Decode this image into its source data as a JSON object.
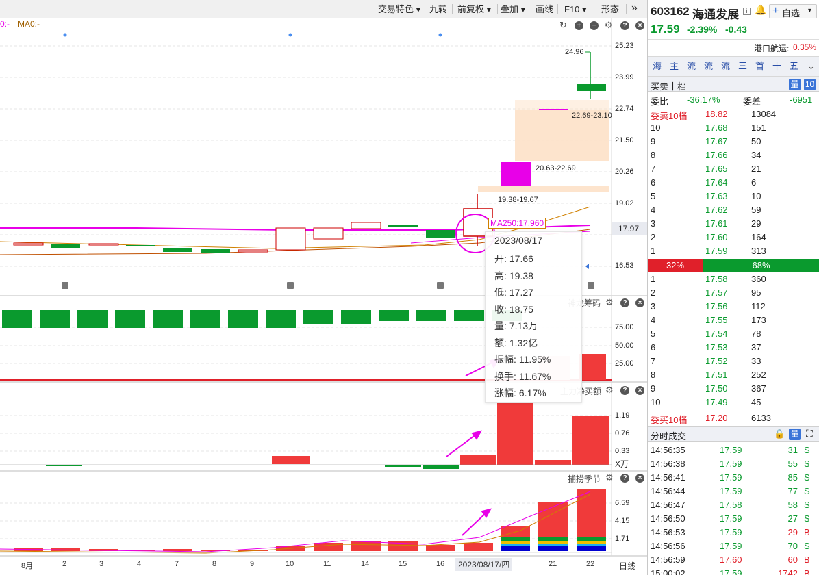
{
  "toolbar": {
    "items": [
      "交易特色",
      "九转",
      "前复权",
      "叠加",
      "画线",
      "F10",
      "形态"
    ],
    "expand": "»"
  },
  "ma_legend": {
    "ma_a": "0:-",
    "ma_b": "MA0:-"
  },
  "price_axis": [
    "25.23",
    "23.99",
    "22.74",
    "21.50",
    "20.26",
    "19.02",
    "17.97",
    "16.53"
  ],
  "annotations": {
    "high_label": "24.96",
    "zone1": "22.69-23.10",
    "zone2": "20.63-22.69",
    "zone3": "19.38-19.67",
    "ma250": "MA250:17.960",
    "current_price_tag": "17.97"
  },
  "panels": {
    "chip": {
      "title": "神龙筹码",
      "axis": [
        "75.00",
        "50.00",
        "25.00"
      ]
    },
    "main_buy": {
      "title": "主力净买额",
      "axis": [
        "1.19",
        "0.76",
        "0.33"
      ],
      "unit": "X万"
    },
    "season": {
      "title": "捕捞季节",
      "axis": [
        "6.59",
        "4.15",
        "1.71"
      ]
    }
  },
  "tooltip": {
    "date": "2023/08/17",
    "rows": [
      {
        "label": "开:",
        "value": "17.66"
      },
      {
        "label": "高:",
        "value": "19.38"
      },
      {
        "label": "低:",
        "value": "17.27"
      },
      {
        "label": "收:",
        "value": "18.75"
      },
      {
        "label": "量:",
        "value": "7.13万"
      },
      {
        "label": "额:",
        "value": "1.32亿"
      },
      {
        "label": "振幅:",
        "value": "11.95%"
      },
      {
        "label": "换手:",
        "value": "11.67%"
      },
      {
        "label": "涨幅:",
        "value": "6.17%"
      }
    ]
  },
  "date_axis": {
    "labels": [
      "8月",
      "2",
      "3",
      "4",
      "7",
      "8",
      "9",
      "10",
      "11",
      "14",
      "15",
      "16",
      "2023/08/17/四",
      "21",
      "22"
    ],
    "period": "日线"
  },
  "stock": {
    "code": "603162",
    "name": "海通发展",
    "price": "17.59",
    "change_pct": "-2.39%",
    "change": "-0.43",
    "watch_label": "自选",
    "sector": "港口航运:",
    "sector_pct": "0.35%"
  },
  "nav_tabs": [
    "海",
    "主",
    "流",
    "流",
    "流",
    "三",
    "首",
    "十",
    "五"
  ],
  "order_book": {
    "title": "买卖十档",
    "depth_badge": "10",
    "ratio_label": "委比",
    "ratio_value": "-36.17%",
    "diff_label": "委差",
    "diff_value": "-6951",
    "ask_total": {
      "label": "委卖10档",
      "price": "18.82",
      "vol": "13084"
    },
    "asks": [
      {
        "lvl": "10",
        "price": "17.68",
        "vol": "151"
      },
      {
        "lvl": "9",
        "price": "17.67",
        "vol": "50"
      },
      {
        "lvl": "8",
        "price": "17.66",
        "vol": "34"
      },
      {
        "lvl": "7",
        "price": "17.65",
        "vol": "21"
      },
      {
        "lvl": "6",
        "price": "17.64",
        "vol": "6"
      },
      {
        "lvl": "5",
        "price": "17.63",
        "vol": "10"
      },
      {
        "lvl": "4",
        "price": "17.62",
        "vol": "59"
      },
      {
        "lvl": "3",
        "price": "17.61",
        "vol": "29"
      },
      {
        "lvl": "2",
        "price": "17.60",
        "vol": "164"
      },
      {
        "lvl": "1",
        "price": "17.59",
        "vol": "313"
      }
    ],
    "sell_pct": "32%",
    "buy_pct": "68%",
    "bids": [
      {
        "lvl": "1",
        "price": "17.58",
        "vol": "360"
      },
      {
        "lvl": "2",
        "price": "17.57",
        "vol": "95"
      },
      {
        "lvl": "3",
        "price": "17.56",
        "vol": "112"
      },
      {
        "lvl": "4",
        "price": "17.55",
        "vol": "173"
      },
      {
        "lvl": "5",
        "price": "17.54",
        "vol": "78"
      },
      {
        "lvl": "6",
        "price": "17.53",
        "vol": "37"
      },
      {
        "lvl": "7",
        "price": "17.52",
        "vol": "33"
      },
      {
        "lvl": "8",
        "price": "17.51",
        "vol": "252"
      },
      {
        "lvl": "9",
        "price": "17.50",
        "vol": "367"
      },
      {
        "lvl": "10",
        "price": "17.49",
        "vol": "45"
      }
    ],
    "bid_total": {
      "label": "委买10档",
      "price": "17.20",
      "vol": "6133"
    }
  },
  "trades": {
    "title": "分时成交",
    "rows": [
      {
        "time": "14:56:35",
        "price": "17.59",
        "vol": "31",
        "side": "S"
      },
      {
        "time": "14:56:38",
        "price": "17.59",
        "vol": "55",
        "side": "S"
      },
      {
        "time": "14:56:41",
        "price": "17.59",
        "vol": "85",
        "side": "S"
      },
      {
        "time": "14:56:44",
        "price": "17.59",
        "vol": "77",
        "side": "S"
      },
      {
        "time": "14:56:47",
        "price": "17.58",
        "vol": "58",
        "side": "S"
      },
      {
        "time": "14:56:50",
        "price": "17.59",
        "vol": "27",
        "side": "S"
      },
      {
        "time": "14:56:53",
        "price": "17.59",
        "vol": "29",
        "side": "B"
      },
      {
        "time": "14:56:56",
        "price": "17.59",
        "vol": "70",
        "side": "S"
      },
      {
        "time": "14:56:59",
        "price": "17.60",
        "vol": "60",
        "side": "B"
      },
      {
        "time": "15:00:02",
        "price": "17.59",
        "vol": "1742",
        "side": "B"
      }
    ]
  },
  "colors": {
    "up": "#e0202a",
    "down": "#0a9a2e",
    "accent": "#e800e8",
    "badge": "#3a74d8"
  }
}
